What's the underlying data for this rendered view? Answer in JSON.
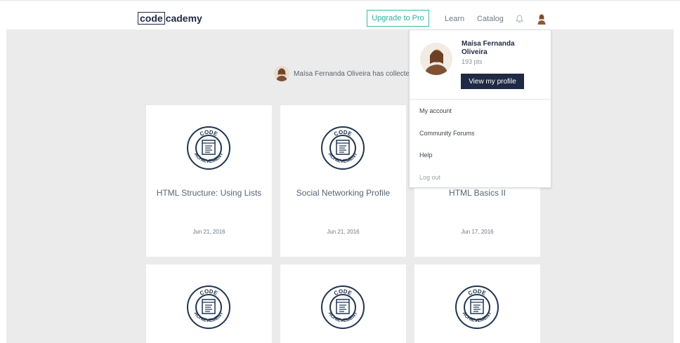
{
  "header": {
    "logo_boxed": "code",
    "logo_rest": "cademy",
    "upgrade_label": "Upgrade to Pro",
    "nav_learn": "Learn",
    "nav_catalog": "Catalog"
  },
  "main": {
    "collected_text": "Maísa Fernanda Oliveira has collected"
  },
  "cards": [
    {
      "title": "HTML Structure: Using Lists",
      "date": "Jun 21, 2016"
    },
    {
      "title": "Social Networking Profile",
      "date": "Jun 21, 2016"
    },
    {
      "title": "HTML Basics II",
      "date": "Jun 17, 2016"
    }
  ],
  "badge": {
    "top_text": "CODE",
    "bottom_text": "ACHIEVEMENT"
  },
  "dropdown": {
    "name": "Maísa Fernanda Oliveira",
    "points": "193 pts",
    "view_profile": "View my profile",
    "items": [
      "My account",
      "Community Forums",
      "Help",
      "Log out"
    ]
  },
  "colors": {
    "navy": "#1f2a44",
    "teal": "#2fb09d",
    "background_gray": "#ebebeb"
  }
}
